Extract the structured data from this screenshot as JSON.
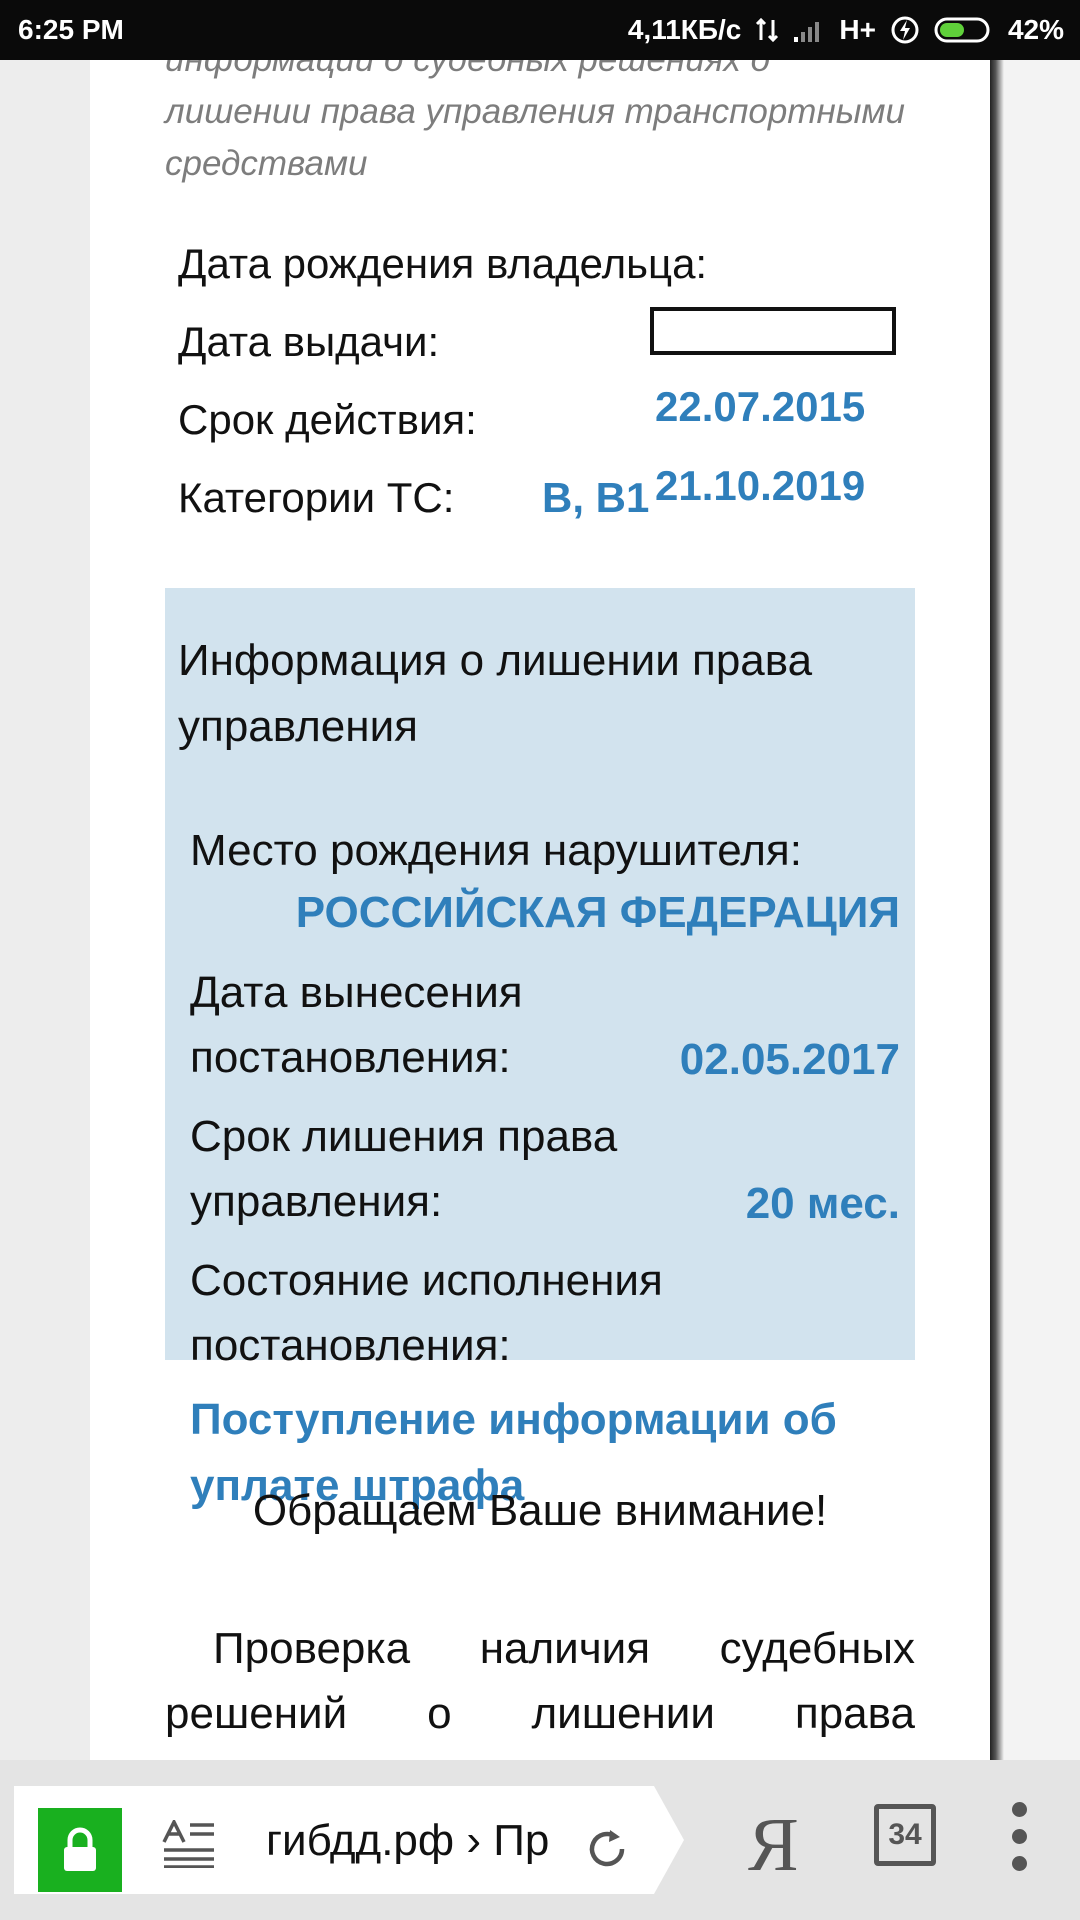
{
  "status_bar": {
    "time": "6:25 PM",
    "speed": "4,11КБ/с",
    "network": "H+",
    "battery": "42%"
  },
  "page": {
    "intro_text": "информации о судебных решениях о лишении права управления транспортными средствами",
    "owner_birth_label": "Дата рождения владельца:",
    "issue_date_label": "Дата выдачи:",
    "validity_label": "Срок действия:",
    "validity_value": "22.07.2015",
    "categories_label": "Категории ТС:",
    "categories_value": "B, B1",
    "categories_date_value": "21.10.2019",
    "panel": {
      "title": "Информация о лишении права управления",
      "birthplace_label": "Место рождения нарушителя:",
      "birthplace_value": "РОССИЙСКАЯ ФЕДЕРАЦИЯ",
      "decision_date_label_1": "Дата вынесения",
      "decision_date_label_2": "постановления:",
      "decision_date_value": "02.05.2017",
      "term_label_1": "Срок лишения права",
      "term_label_2": "управления:",
      "term_value": "20 мес.",
      "state_label_1": "Состояние исполнения",
      "state_label_2": "постановления:"
    },
    "state_value": "Поступление информации об уплате штрафа",
    "notice": "Обращаем Ваше внимание!",
    "paragraph": "Проверка наличия судебных решений о лишении права управления проводится"
  },
  "browser_bar": {
    "url": "гибдд.рф › Пр",
    "tabs_count": "34",
    "search_logo": "Я"
  }
}
